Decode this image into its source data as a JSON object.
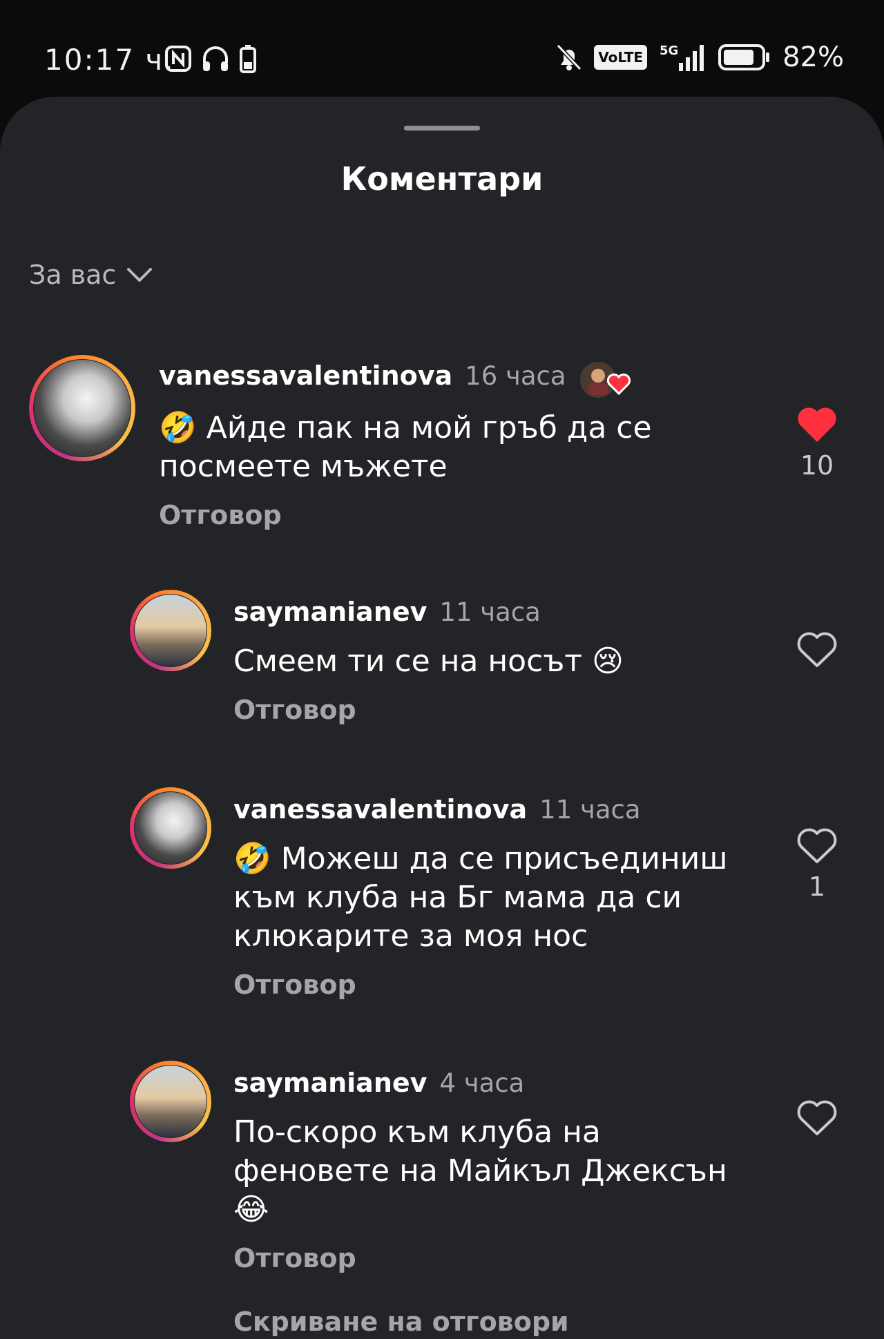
{
  "status_bar": {
    "time": "10:17 ч.",
    "left_icons": [
      "nfc-icon",
      "headphones-icon",
      "battery-saver-icon"
    ],
    "right_icons": [
      "mute-icon",
      "volte-badge",
      "5g-signal-icon",
      "battery-icon"
    ],
    "volte": "VoLTE",
    "network": "5G",
    "battery_percent": "82%",
    "battery_level": 0.82
  },
  "sheet": {
    "title": "Коментари",
    "sort_label": "За вас"
  },
  "comments": [
    {
      "username": "vanessavalentinova",
      "time": "16 часа",
      "text": "🤣 Айде пак на мой гръб да се посмеете мъжете",
      "reply_label": "Отговор",
      "likes": "10",
      "liked": true,
      "creator_liked": true
    },
    {
      "username": "saymanianev",
      "time": "11 часа",
      "text": "Смеем ти се на носът 😢",
      "reply_label": "Отговор",
      "likes": "",
      "liked": false
    },
    {
      "username": "vanessavalentinova",
      "time": "11 часа",
      "text": "🤣 Можеш да се присъединиш към клуба на Бг мама да си клюкарите за моя нос",
      "reply_label": "Отговор",
      "likes": "1",
      "liked": false
    },
    {
      "username": "saymanianev",
      "time": "4 часа",
      "text": "По-скоро към клуба на феновете на Майкъл Джексън 😂",
      "reply_label": "Отговор",
      "likes": "",
      "liked": false
    }
  ],
  "hide_replies_label": "Скриване на отговори",
  "colors": {
    "sheet_bg": "#232427",
    "like_red": "#ff3040",
    "muted_text": "#a4a6ab"
  }
}
